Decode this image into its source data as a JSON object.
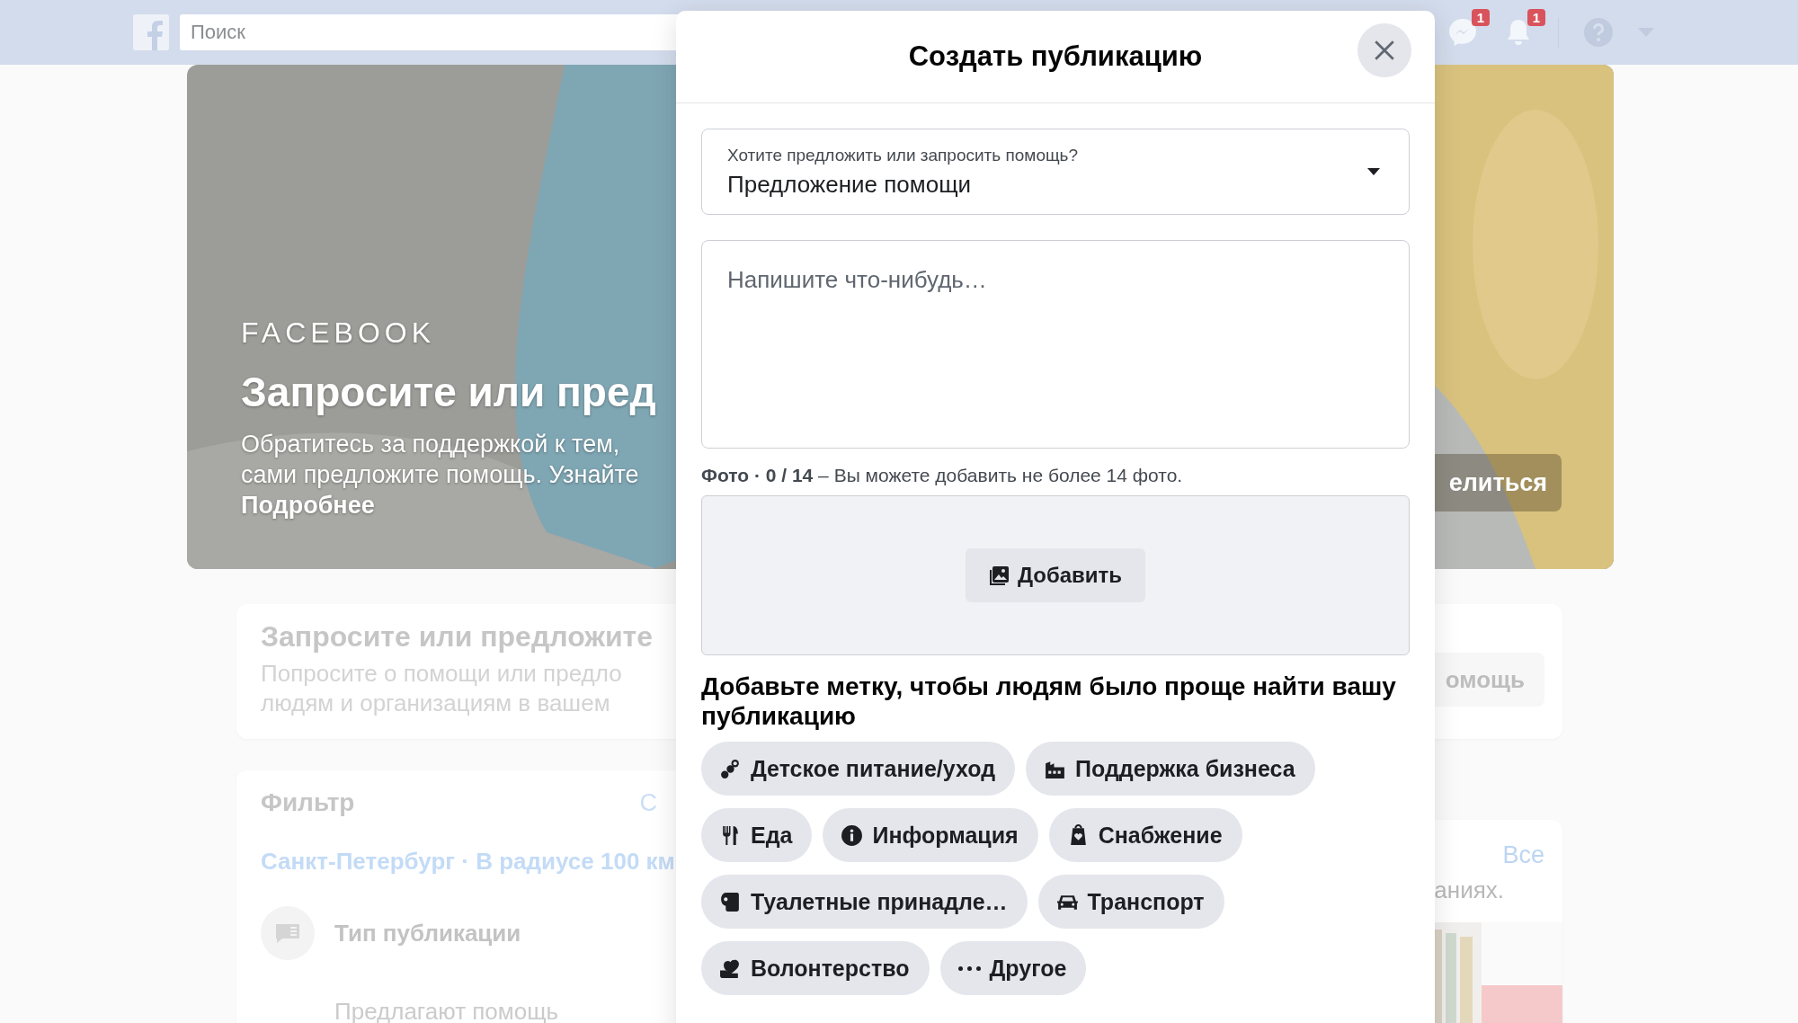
{
  "top_bar": {
    "search": {
      "placeholder": "Поиск"
    },
    "notifications": [
      {
        "kind": "messenger",
        "count": "1"
      },
      {
        "kind": "bell",
        "count": "1"
      }
    ]
  },
  "hero": {
    "brand": "FACEBOOK",
    "title": "Запросите или пред",
    "description_lines": [
      "Обратитесь за поддержкой к тем,",
      "сами предложите помощь. Узнайте"
    ],
    "link": "Подробнее",
    "share_button": "елиться"
  },
  "request_card": {
    "title": "Запросите или предложите",
    "lines": [
      "Попросите о помощи или предло",
      "людям и организациям в вашем"
    ],
    "button": "омощь"
  },
  "filter_card": {
    "title": "Фильтр",
    "reset_link": "С",
    "location": "Санкт-Петербург · В радиусе 100 км",
    "post_type_label": "Тип публикации",
    "option": "Предлагают помощь"
  },
  "suggestions_card": {
    "link": "Все",
    "text": "аниях."
  },
  "dialog": {
    "title": "Создать публикацию",
    "type_select": {
      "label": "Хотите предложить или запросить помощь?",
      "value": "Предложение помощи"
    },
    "message": {
      "placeholder": "Напишите что-нибудь…"
    },
    "photos": {
      "text": "**Фото · 0 / 14** – Вы можете добавить не более 14 фото.",
      "add_button": "Добавить"
    },
    "tags_heading": "Добавьте метку, чтобы людям было проще найти вашу публикацию",
    "tags": [
      {
        "label": "Детское питание/уход",
        "kind": "baby"
      },
      {
        "label": "Поддержка бизнеса",
        "kind": "business"
      },
      {
        "label": "Еда",
        "kind": "food"
      },
      {
        "label": "Информация",
        "kind": "info"
      },
      {
        "label": "Снабжение",
        "kind": "supplies"
      },
      {
        "label": "Туалетные принадле…",
        "kind": "toiletries"
      },
      {
        "label": "Транспорт",
        "kind": "transport"
      },
      {
        "label": "Волонтерство",
        "kind": "volunteer"
      },
      {
        "label": "Другое",
        "kind": "other"
      }
    ]
  }
}
